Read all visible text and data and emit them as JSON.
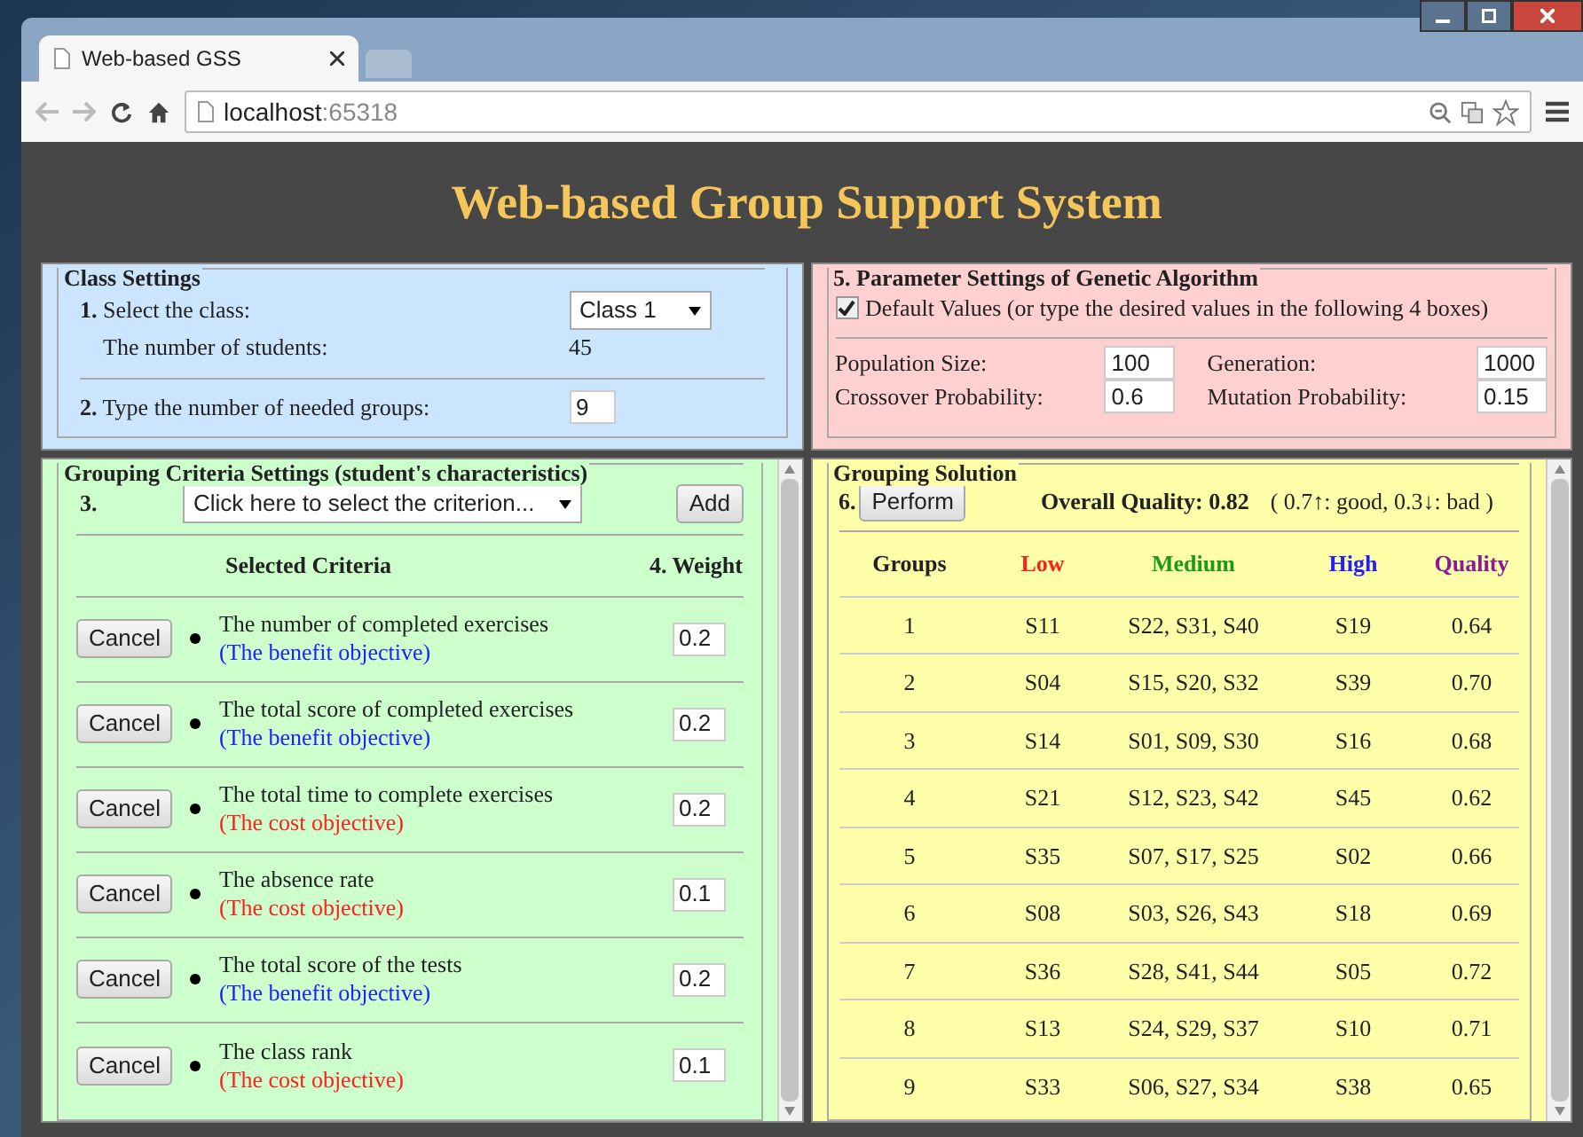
{
  "browser": {
    "tab_title": "Web-based GSS",
    "url_host": "localhost",
    "url_port": ":65318"
  },
  "page_title": "Web-based Group Support System",
  "class_settings": {
    "legend": "Class Settings",
    "select_label": "**1.** Select the class:",
    "class_value": "Class 1",
    "students_label": "The number of students:",
    "students_value": "45",
    "groups_label": "**2.** Type the number of needed groups:",
    "groups_value": "9"
  },
  "criteria": {
    "legend": "Grouping Criteria Settings (student's characteristics)",
    "step": "3.",
    "select_placeholder": "Click here to select the criterion...",
    "add_button": "Add",
    "header_criteria": "Selected Criteria",
    "header_weight": "4. Weight",
    "items": [
      {
        "cancel": "Cancel",
        "name": "The number of completed exercises",
        "objective": "(The benefit objective)",
        "kind": "benefit",
        "weight": "0.2"
      },
      {
        "cancel": "Cancel",
        "name": "The total score of completed exercises",
        "objective": "(The benefit objective)",
        "kind": "benefit",
        "weight": "0.2"
      },
      {
        "cancel": "Cancel",
        "name": "The total time to complete exercises",
        "objective": "(The cost objective)",
        "kind": "cost",
        "weight": "0.2"
      },
      {
        "cancel": "Cancel",
        "name": "The absence rate",
        "objective": "(The cost objective)",
        "kind": "cost",
        "weight": "0.1"
      },
      {
        "cancel": "Cancel",
        "name": "The total score of the tests",
        "objective": "(The benefit objective)",
        "kind": "benefit",
        "weight": "0.2"
      },
      {
        "cancel": "Cancel",
        "name": "The class rank",
        "objective": "(The cost objective)",
        "kind": "cost",
        "weight": "0.1"
      }
    ]
  },
  "parameters": {
    "legend": "5. Parameter Settings of Genetic Algorithm",
    "default_checked": true,
    "default_label": "Default Values (or type the desired values in the following 4 boxes)",
    "fields": [
      {
        "label": "Population Size:",
        "value": "100"
      },
      {
        "label": "Generation:",
        "value": "1000"
      },
      {
        "label": "Crossover Probability:",
        "value": "0.6"
      },
      {
        "label": "Mutation Probability:",
        "value": "0.15"
      }
    ]
  },
  "solution": {
    "legend": "Grouping Solution",
    "step": "6.",
    "perform_button": "Perform",
    "overall": "Overall Quality: 0.82",
    "note": "( 0.7↑: good, 0.3↓: bad )",
    "columns": [
      {
        "label": "Groups",
        "color": "#222222"
      },
      {
        "label": "Low",
        "color": "#ff2020"
      },
      {
        "label": "Medium",
        "color": "#1a9a1a"
      },
      {
        "label": "High",
        "color": "#2020ff"
      },
      {
        "label": "Quality",
        "color": "#8a1a9a"
      }
    ],
    "rows": [
      [
        "1",
        "S11",
        "S22, S31, S40",
        "S19",
        "0.64"
      ],
      [
        "2",
        "S04",
        "S15, S20, S32",
        "S39",
        "0.70"
      ],
      [
        "3",
        "S14",
        "S01, S09, S30",
        "S16",
        "0.68"
      ],
      [
        "4",
        "S21",
        "S12, S23, S42",
        "S45",
        "0.62"
      ],
      [
        "5",
        "S35",
        "S07, S17, S25",
        "S02",
        "0.66"
      ],
      [
        "6",
        "S08",
        "S03, S26, S43",
        "S18",
        "0.69"
      ],
      [
        "7",
        "S36",
        "S28, S41, S44",
        "S05",
        "0.72"
      ],
      [
        "8",
        "S13",
        "S24, S29, S37",
        "S10",
        "0.71"
      ],
      [
        "9",
        "S33",
        "S06, S27, S34",
        "S38",
        "0.65"
      ]
    ]
  }
}
